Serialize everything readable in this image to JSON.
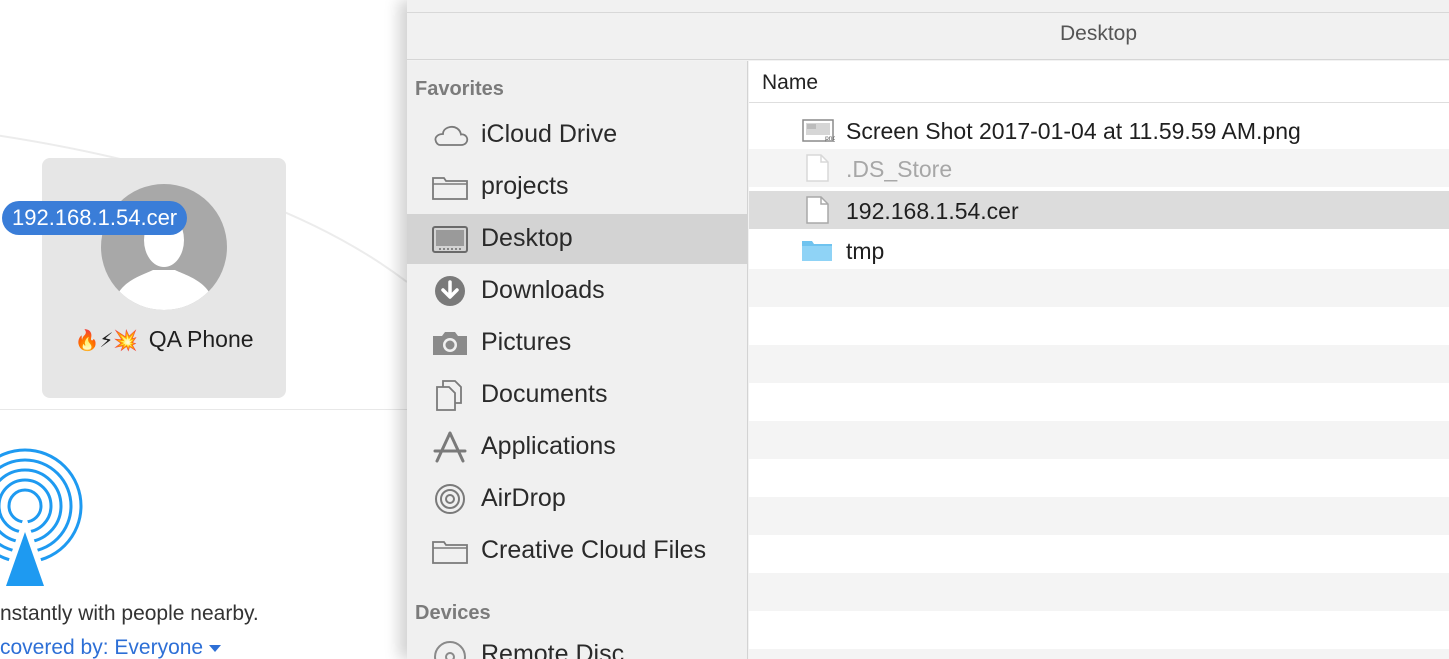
{
  "airdrop": {
    "peer": {
      "emoji": "🔥⚡💥",
      "name": "QA Phone"
    },
    "dragging_file": "192.168.1.54.cer",
    "description": "nstantly with people nearby.",
    "discoverable": "covered by: Everyone"
  },
  "finder": {
    "path_title": "Desktop",
    "sidebar": {
      "favorites_heading": "Favorites",
      "items": [
        {
          "label": "iCloud Drive",
          "icon": "cloud-icon"
        },
        {
          "label": "projects",
          "icon": "folder-icon"
        },
        {
          "label": "Desktop",
          "icon": "desktop-icon",
          "selected": true
        },
        {
          "label": "Downloads",
          "icon": "download-icon"
        },
        {
          "label": "Pictures",
          "icon": "camera-icon"
        },
        {
          "label": "Documents",
          "icon": "documents-icon"
        },
        {
          "label": "Applications",
          "icon": "applications-icon"
        },
        {
          "label": "AirDrop",
          "icon": "airdrop-icon"
        },
        {
          "label": "Creative Cloud Files",
          "icon": "folder-icon"
        }
      ],
      "devices_heading": "Devices",
      "devices": [
        {
          "label": "Remote Disc",
          "icon": "disc-icon"
        }
      ]
    },
    "list": {
      "column_name": "Name",
      "files": [
        {
          "name": "Screen Shot 2017-01-04 at 11.59.59 AM.png",
          "icon": "png-file-icon"
        },
        {
          "name": ".DS_Store",
          "icon": "blank-file-icon",
          "dimmed": true
        },
        {
          "name": "192.168.1.54.cer",
          "icon": "blank-file-icon",
          "selected": true
        },
        {
          "name": "tmp",
          "icon": "folder-icon"
        }
      ]
    }
  },
  "colors": {
    "accent_blue": "#3a7dd8",
    "link_blue": "#2d6fd6",
    "folder_blue": "#6fc3ef",
    "selection_gray": "#d3d3d3"
  }
}
